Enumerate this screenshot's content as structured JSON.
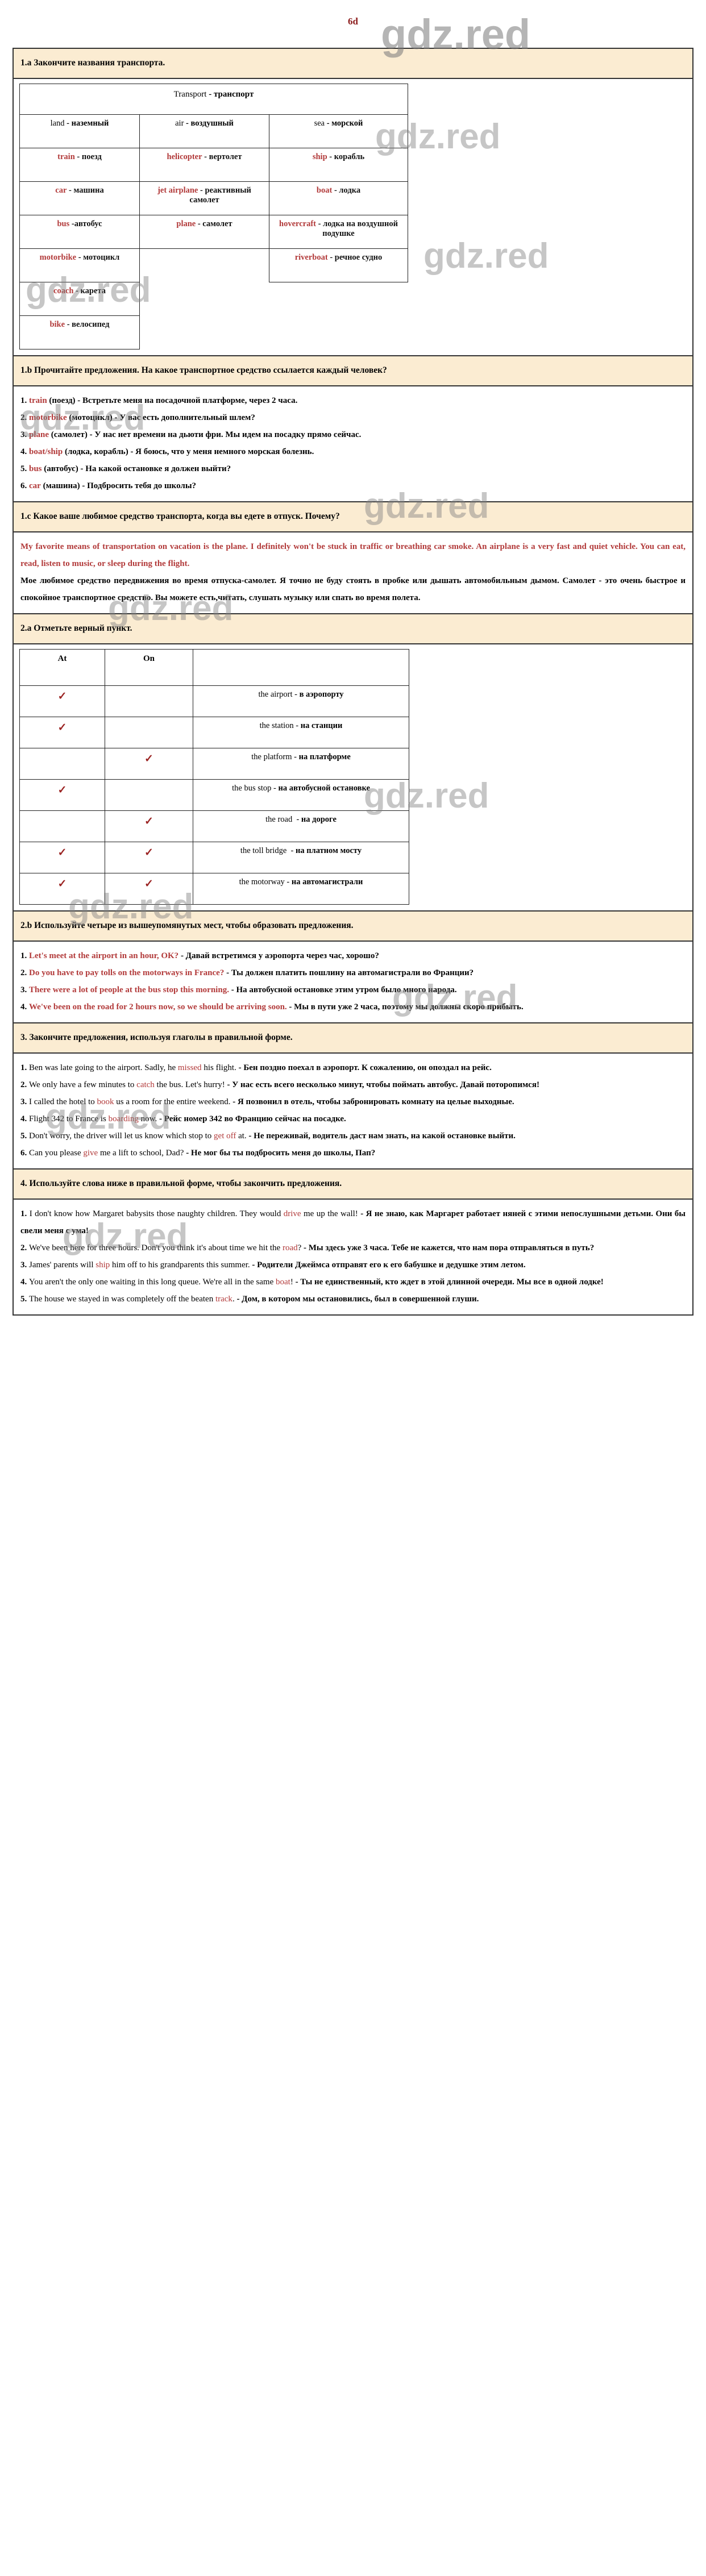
{
  "page": {
    "number": "6d",
    "watermark": "gdz.red"
  },
  "section_1a": {
    "task": "1.a Закончите названия транспорта.",
    "table": {
      "header": "Transport - транспорт",
      "categories": [
        "land - наземный",
        "air - воздушный",
        "sea - морской"
      ],
      "rows": [
        {
          "land": {
            "en": "train",
            "ru": " - поезд"
          },
          "air": {
            "en": "helicopter",
            "ru": " - вертолет"
          },
          "sea": {
            "en": "ship",
            "ru": " - корабль"
          }
        },
        {
          "land": {
            "en": "car",
            "ru": " - машина"
          },
          "air": {
            "en": "jet airplane",
            "ru": " - реактивный самолет"
          },
          "sea": {
            "en": "boat",
            "ru": " - лодка"
          }
        },
        {
          "land": {
            "en": "bus",
            "ru": " -автобус"
          },
          "air": {
            "en": "plane",
            "ru": " - самолет"
          },
          "sea": {
            "en": "hovercraft",
            "ru": " - лодка на воздушной подушке"
          }
        },
        {
          "land": {
            "en": "motorbike",
            "ru": " - мотоцикл"
          },
          "air": {
            "en": "",
            "ru": ""
          },
          "sea": {
            "en": "riverboat",
            "ru": " - речное судно"
          }
        },
        {
          "land": {
            "en": "coach",
            "ru": " - карета"
          },
          "air": {
            "en": "",
            "ru": ""
          },
          "sea": {
            "en": "",
            "ru": ""
          }
        },
        {
          "land": {
            "en": "bike",
            "ru": " - велосипед"
          },
          "air": {
            "en": "",
            "ru": ""
          },
          "sea": {
            "en": "",
            "ru": ""
          }
        }
      ]
    }
  },
  "section_1b": {
    "task": "1.b Прочитайте предложения. На какое транспортное средство ссылается каждый человек?",
    "items": [
      {
        "num": "1. ",
        "en": "train",
        "rest": " (поезд) - Встретьте меня на посадочной платформе, через 2 часа."
      },
      {
        "num": "2. ",
        "en": "motorbike",
        "rest": " (мотоцикл) - У вас есть дополнительный шлем?"
      },
      {
        "num": "3. ",
        "en": "plane",
        "rest": " (самолет) - У нас нет времени на дьюти фри. Мы идем на посадку прямо сейчас."
      },
      {
        "num": "4. ",
        "en": "boat/ship",
        "rest": " (лодка, корабль) - Я боюсь, что у меня немного морская болезнь."
      },
      {
        "num": "5. ",
        "en": "bus",
        "rest": " (автобус) - На какой остановке я должен выйти?"
      },
      {
        "num": "6. ",
        "en": "car",
        "rest": " (машина) - Подбросить тебя до школы?"
      }
    ]
  },
  "section_1c": {
    "task": "1.c Какое ваше любимое средство транспорта, когда вы едете в отпуск. Почему?",
    "answer_en": "My favorite means of transportation on vacation is the plane. I definitely won't be stuck in traffic or breathing car smoke. An airplane is a very fast and quiet vehicle. You can eat, read, listen to music, or sleep during the flight.",
    "answer_ru": "Мое любимое средство передвижения во время отпуска-самолет. Я точно не буду стоять в пробке или дышать автомобильным дымом. Самолет - это очень быстрое и спокойное транспортное средство. Вы можете есть,читать, слушать музыку или спать во время полета."
  },
  "section_2a": {
    "task": "2.a Отметьте верный пункт.",
    "columns": [
      "At",
      "On"
    ],
    "tick": "✓",
    "rows": [
      {
        "at": true,
        "on": false,
        "en": "the airport - ",
        "ru": "в аэропорту"
      },
      {
        "at": true,
        "on": false,
        "en": "the station - ",
        "ru": "на станции"
      },
      {
        "at": false,
        "on": true,
        "en": "the platform - ",
        "ru": "на платформе"
      },
      {
        "at": true,
        "on": false,
        "en": "the bus stop - ",
        "ru": "на автобусной остановке"
      },
      {
        "at": false,
        "on": true,
        "en": "the road  - ",
        "ru": "на дороге"
      },
      {
        "at": true,
        "on": true,
        "en": "the toll bridge  - ",
        "ru": "на платном мосту"
      },
      {
        "at": true,
        "on": true,
        "en": "the motorway - ",
        "ru": "на автомагистрали"
      }
    ]
  },
  "section_2b": {
    "task": "2.b Используйте четыре из вышеупомянутых мест, чтобы образовать предложения.",
    "items": [
      {
        "num": "1. ",
        "en": "Let's meet at the airport in an hour, OK?",
        "rest": " - Давай встретимся у аэропорта через час, хорошо?"
      },
      {
        "num": "2. ",
        "en": "Do you have to pay tolls on the motorways in France?",
        "rest": " - Ты должен платить пошлину на автомагистрали во Франции?"
      },
      {
        "num": "3. ",
        "en": "There were a lot of people at the bus stop this morning.",
        "rest": " - На автобусной остановке этим утром было много народа."
      },
      {
        "num": "4. ",
        "en": "We've been on the road for 2 hours now, so we should be arriving soon.",
        "rest": " - Мы в пути уже 2 часа, поэтому мы должны скоро прибыть."
      }
    ]
  },
  "section_3": {
    "task": "3. Закончите предложения, используя глаголы в правильной форме.",
    "items": [
      {
        "num": "1. ",
        "pre": "Ben was late going to the airport. Sadly, he ",
        "hl": "missed",
        "post": " his flight.",
        "ru": " - Бен поздно поехал в аэропорт. К сожалению, он опоздал на рейс."
      },
      {
        "num": "2. ",
        "pre": "We only have a few minutes to ",
        "hl": "catch",
        "post": " the bus. Let's hurry!",
        "ru": " - У нас есть всего несколько минут, чтобы поймать автобус. Давай поторопимся!"
      },
      {
        "num": "3. ",
        "pre": "I called the hotel to ",
        "hl": "book",
        "post": " us a room for the entire weekend.",
        "ru": " - Я позвонил в отель, чтобы забронировать комнату на целые выходные."
      },
      {
        "num": "4. ",
        "pre": "Flight 342 to France is ",
        "hl": "boarding",
        "post": " now.",
        "ru": " - Рейс номер 342 во Францию сейчас на посадке."
      },
      {
        "num": "5. ",
        "pre": "Don't worry, the driver will let us know which stop to ",
        "hl": "get off",
        "post": " at.",
        "ru": " - Не переживай, водитель даст нам знать, на какой остановке выйти."
      },
      {
        "num": "6. ",
        "pre": "Can you please ",
        "hl": "give",
        "post": " me a lift to school, Dad?",
        "ru": " - Не мог бы ты подбросить меня до школы, Пап?"
      }
    ]
  },
  "section_4": {
    "task": "4. Используйте слова ниже в правильной форме, чтобы закончить предложения.",
    "items": [
      {
        "num": "1. ",
        "pre": "I don't know how Margaret babysits those naughty children. They would ",
        "hl": "drive",
        "post": " me up the wall!",
        "ru": " - Я не знаю, как Маргарет работает няней с этими непослушными детьми. Они бы свели меня с ума!"
      },
      {
        "num": "2. ",
        "pre": "We've been here for three hours. Don't you think it's about time we hit the ",
        "hl": "road",
        "post": "?",
        "ru": " - Мы здесь уже 3 часа. Тебе не кажется, что нам пора отправляться в путь?"
      },
      {
        "num": "3. ",
        "pre": "James' parents will ",
        "hl": "ship",
        "post": " him off to his grandparents this summer.",
        "ru": " - Родители Джеймса отправят его к его бабушке и дедушке этим летом."
      },
      {
        "num": "4. ",
        "pre": "You aren't the only one waiting in this long queue. We're all in the same ",
        "hl": "boat",
        "post": "!",
        "ru": " - Ты не единственный, кто ждет в этой длинной очереди. Мы все в одной лодке!"
      },
      {
        "num": "5. ",
        "pre": "The house we stayed in was completely off the beaten ",
        "hl": "track",
        "post": ".",
        "ru": " - Дом, в котором мы остановились, был в совершенной глуши."
      }
    ]
  }
}
